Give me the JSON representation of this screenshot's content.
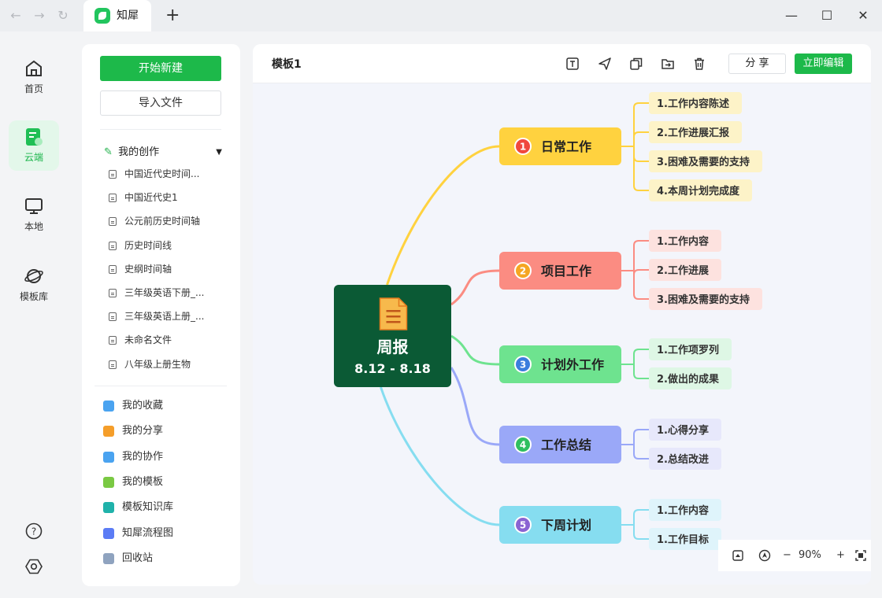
{
  "titlebar": {
    "tab_title": "知犀",
    "new_tab": "+",
    "nav_icons": [
      "back-icon",
      "forward-icon",
      "refresh-icon"
    ],
    "window_icons": [
      "minimize-icon",
      "maximize-icon",
      "close-icon"
    ]
  },
  "rail": {
    "items": [
      {
        "label": "首页",
        "icon": "home-icon"
      },
      {
        "label": "云端",
        "icon": "cloud-doc-icon",
        "active": true
      },
      {
        "label": "本地",
        "icon": "monitor-icon"
      },
      {
        "label": "模板库",
        "icon": "planet-icon"
      }
    ],
    "help_icon": "help-icon",
    "settings_icon": "settings-icon"
  },
  "sidebar": {
    "new_label": "开始新建",
    "import_label": "导入文件",
    "my_create_label": "我的创作",
    "files": [
      "中国近代史时间...",
      "中国近代史1",
      "公元前历史时间轴",
      "历史时间线",
      "史纲时间轴",
      "三年级英语下册_...",
      "三年级英语上册_...",
      "未命名文件",
      "八年级上册生物"
    ],
    "menu": [
      {
        "label": "我的收藏",
        "icon": "star-folder-icon",
        "color": "#4aa3f0"
      },
      {
        "label": "我的分享",
        "icon": "share-icon",
        "color": "#f59e2a"
      },
      {
        "label": "我的协作",
        "icon": "users-icon",
        "color": "#4aa3f0"
      },
      {
        "label": "我的模板",
        "icon": "template-icon",
        "color": "#7ac943"
      },
      {
        "label": "模板知识库",
        "icon": "book-icon",
        "color": "#20b2aa"
      },
      {
        "label": "知犀流程图",
        "icon": "flowchart-icon",
        "color": "#5b7cf5"
      },
      {
        "label": "回收站",
        "icon": "trash-icon",
        "color": "#8fa3bf"
      }
    ]
  },
  "toolbar": {
    "doc_title": "模板1",
    "tools": [
      "text-icon",
      "send-icon",
      "copy-icon",
      "export-icon",
      "delete-icon"
    ],
    "share_label": "分 享",
    "edit_label": "立即编辑"
  },
  "zoom": {
    "level": "90%",
    "minus": "−",
    "plus": "+"
  },
  "mindmap": {
    "root": {
      "title": "周报",
      "subtitle": "8.12 - 8.18",
      "color": "#0b5a35"
    },
    "branches": [
      {
        "num": "1",
        "label": "日常工作",
        "color": "#ffd23f",
        "leafBg": "#fdf3c8",
        "numColor": "#f0483e",
        "children": [
          "1.工作内容陈述",
          "2.工作进展汇报",
          "3.困难及需要的支持",
          "4.本周计划完成度"
        ]
      },
      {
        "num": "2",
        "label": "项目工作",
        "color": "#fb8c82",
        "leafBg": "#fde2df",
        "numColor": "#f5a623",
        "children": [
          "1.工作内容",
          "2.工作进展",
          "3.困难及需要的支持"
        ]
      },
      {
        "num": "3",
        "label": "计划外工作",
        "color": "#6ee38f",
        "leafBg": "#def7e5",
        "numColor": "#3b7ddd",
        "children": [
          "1.工作项罗列",
          "2.做出的成果"
        ]
      },
      {
        "num": "4",
        "label": "工作总结",
        "color": "#9aa8f8",
        "leafBg": "#e7e8fb",
        "numColor": "#2fbf5f",
        "children": [
          "1.心得分享",
          "2.总结改进"
        ]
      },
      {
        "num": "5",
        "label": "下周计划",
        "color": "#86ddf0",
        "leafBg": "#dff4fb",
        "numColor": "#8a63d2",
        "children": [
          "1.工作内容",
          "1.工作目标"
        ]
      }
    ]
  }
}
